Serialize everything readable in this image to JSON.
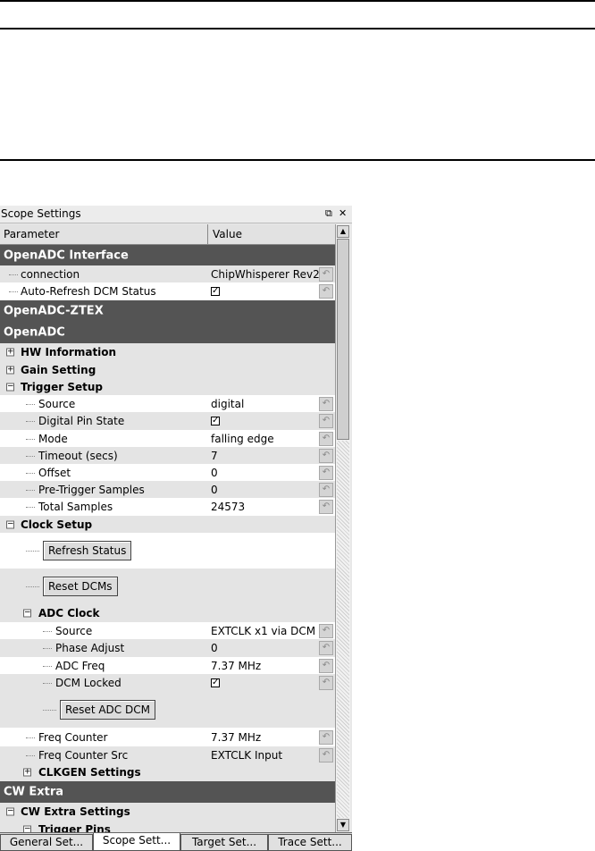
{
  "panel": {
    "title": "Scope Settings",
    "controls": [
      "⧉",
      "✕"
    ]
  },
  "tree": {
    "header": {
      "param": "Parameter",
      "value": "Value"
    },
    "openadc_interface": {
      "title": "OpenADC Interface",
      "connection_label": "connection",
      "connection_value": "ChipWhisperer Rev2",
      "auto_refresh_label": "Auto-Refresh DCM Status",
      "auto_refresh_checked": true
    },
    "openadc_ztex_title": "OpenADC-ZTEX",
    "openadc_title": "OpenADC",
    "hw_information": "HW Information",
    "gain_setting": "Gain Setting",
    "trigger_setup": {
      "title": "Trigger Setup",
      "source_label": "Source",
      "source_value": "digital",
      "digital_pin_label": "Digital Pin State",
      "digital_pin_checked": true,
      "mode_label": "Mode",
      "mode_value": "falling edge",
      "timeout_label": "Timeout (secs)",
      "timeout_value": "7",
      "offset_label": "Offset",
      "offset_value": "0",
      "pretrigger_label": "Pre-Trigger Samples",
      "pretrigger_value": "0",
      "total_label": "Total Samples",
      "total_value": "24573"
    },
    "clock_setup": {
      "title": "Clock Setup",
      "refresh_status": "Refresh Status",
      "reset_dcms": "Reset DCMs",
      "adc_clock": {
        "title": "ADC Clock",
        "source_label": "Source",
        "source_value": "EXTCLK x1 via DCM",
        "phase_label": "Phase Adjust",
        "phase_value": "0",
        "freq_label": "ADC Freq",
        "freq_value": "7.37 MHz",
        "locked_label": "DCM Locked",
        "locked_checked": true,
        "reset_adc_dcm": "Reset ADC DCM"
      },
      "freq_counter_label": "Freq Counter",
      "freq_counter_value": "7.37 MHz",
      "freq_counter_src_label": "Freq Counter Src",
      "freq_counter_src_value": "EXTCLK Input",
      "clkgen_settings": "CLKGEN Settings"
    },
    "cw_extra": {
      "title": "CW Extra",
      "settings": "CW Extra Settings",
      "trigger_pins": "Trigger Pins"
    }
  },
  "tabs": [
    "General Set...",
    "Scope Sett...",
    "Target Set...",
    "Trace Sett..."
  ],
  "active_tab": 1,
  "check_glyph": "✓",
  "reset_glyph": "↶"
}
